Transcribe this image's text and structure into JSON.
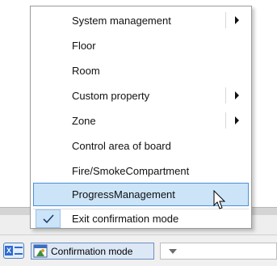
{
  "menu": {
    "items": [
      {
        "label": "System management",
        "has_submenu": true
      },
      {
        "label": "Floor",
        "has_submenu": false
      },
      {
        "label": "Room",
        "has_submenu": false
      },
      {
        "label": "Custom property",
        "has_submenu": true
      },
      {
        "label": "Zone",
        "has_submenu": true
      },
      {
        "label": "Control area of board",
        "has_submenu": false
      },
      {
        "label": "Fire/SmokeCompartment",
        "has_submenu": false
      },
      {
        "label": "ProgressManagement",
        "has_submenu": false,
        "highlighted": true
      }
    ],
    "exit_item": {
      "label": "Exit confirmation mode",
      "checked": true
    }
  },
  "toolbar": {
    "ex_icon": "excel-export-icon",
    "confirmation_mode_icon": "confirmation-mode-icon",
    "confirmation_mode_label": "Confirmation mode",
    "dropdown_value": ""
  },
  "colors": {
    "highlight_bg": "#cce4f7",
    "highlight_border": "#4d8fd6",
    "menu_border": "#9a9a9a",
    "button_bg": "#dde8f6"
  }
}
